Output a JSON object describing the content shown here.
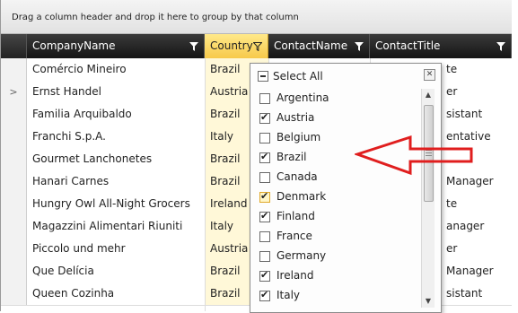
{
  "group_panel": {
    "hint": "Drag a column header and drop it here to group by that column"
  },
  "columns": [
    {
      "key": "company",
      "label": "CompanyName",
      "filter_icon": "funnel-icon"
    },
    {
      "key": "country",
      "label": "Country",
      "filter_icon": "funnel-icon",
      "active": true
    },
    {
      "key": "contact_name",
      "label": "ContactName",
      "filter_icon": "funnel-icon"
    },
    {
      "key": "contact_title",
      "label": "ContactTitle",
      "filter_icon": "funnel-icon"
    }
  ],
  "rows": [
    {
      "indicator": "",
      "company": "Comércio Mineiro",
      "country": "Brazil",
      "contact_title": "te"
    },
    {
      "indicator": ">",
      "company": "Ernst Handel",
      "country": "Austria",
      "contact_title": "er"
    },
    {
      "indicator": "",
      "company": "Familia Arquibaldo",
      "country": "Brazil",
      "contact_title": "sistant"
    },
    {
      "indicator": "",
      "company": "Franchi S.p.A.",
      "country": "Italy",
      "contact_title": "entative"
    },
    {
      "indicator": "",
      "company": "Gourmet Lanchonetes",
      "country": "Brazil",
      "contact_title": ""
    },
    {
      "indicator": "",
      "company": "Hanari Carnes",
      "country": "Brazil",
      "contact_title": "Manager"
    },
    {
      "indicator": "",
      "company": "Hungry Owl All-Night Grocers",
      "country": "Ireland",
      "contact_title": "te"
    },
    {
      "indicator": "",
      "company": "Magazzini Alimentari Riuniti",
      "country": "Italy",
      "contact_title": "anager"
    },
    {
      "indicator": "",
      "company": "Piccolo und mehr",
      "country": "Austria",
      "contact_title": "er"
    },
    {
      "indicator": "",
      "company": "Que Delícia",
      "country": "Brazil",
      "contact_title": "Manager"
    },
    {
      "indicator": "",
      "company": "Queen Cozinha",
      "country": "Brazil",
      "contact_title": "sistant"
    }
  ],
  "filter_popup": {
    "select_all_label": "Select All",
    "close_icon": "close-icon",
    "items": [
      {
        "label": "Argentina",
        "checked": false
      },
      {
        "label": "Austria",
        "checked": true
      },
      {
        "label": "Belgium",
        "checked": false
      },
      {
        "label": "Brazil",
        "checked": true
      },
      {
        "label": "Canada",
        "checked": false
      },
      {
        "label": "Denmark",
        "checked": true,
        "highlighted": true
      },
      {
        "label": "Finland",
        "checked": true
      },
      {
        "label": "France",
        "checked": false
      },
      {
        "label": "Germany",
        "checked": false
      },
      {
        "label": "Ireland",
        "checked": true
      },
      {
        "label": "Italy",
        "checked": true
      }
    ]
  },
  "annotation": {
    "arrow_color": "#e01e1e",
    "arrow_icon": "red-arrow-icon"
  },
  "colors": {
    "header_dark": "#1e1e1e",
    "active_header": "#f7c94a",
    "country_cell": "#fff8d8"
  }
}
